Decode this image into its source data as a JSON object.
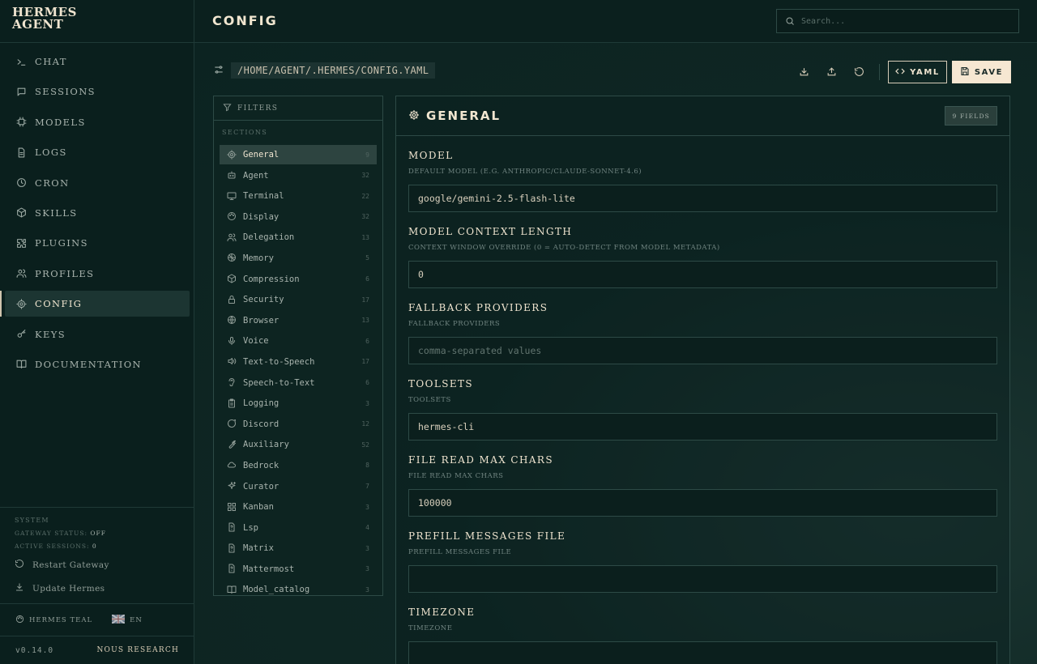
{
  "brand": {
    "line1": "HERMES",
    "line2": "AGENT"
  },
  "nav": [
    {
      "label": "CHAT",
      "icon": "terminal-icon",
      "active": false
    },
    {
      "label": "SESSIONS",
      "icon": "message-icon",
      "active": false
    },
    {
      "label": "MODELS",
      "icon": "cpu-icon",
      "active": false
    },
    {
      "label": "LOGS",
      "icon": "file-icon",
      "active": false
    },
    {
      "label": "CRON",
      "icon": "clock-icon",
      "active": false
    },
    {
      "label": "SKILLS",
      "icon": "package-icon",
      "active": false
    },
    {
      "label": "PLUGINS",
      "icon": "puzzle-icon",
      "active": false
    },
    {
      "label": "PROFILES",
      "icon": "users-icon",
      "active": false
    },
    {
      "label": "CONFIG",
      "icon": "gear-icon",
      "active": true
    },
    {
      "label": "KEYS",
      "icon": "key-icon",
      "active": false
    },
    {
      "label": "DOCUMENTATION",
      "icon": "book-icon",
      "active": false
    }
  ],
  "system": {
    "label": "SYSTEM",
    "gateway_label": "GATEWAY STATUS:",
    "gateway_value": "OFF",
    "sessions_label": "ACTIVE SESSIONS:",
    "sessions_value": "0",
    "restart": "Restart Gateway",
    "update": "Update Hermes"
  },
  "theme": {
    "name": "HERMES TEAL",
    "lang": "EN"
  },
  "footer": {
    "version": "v0.14.0",
    "company": "NOUS RESEARCH"
  },
  "header": {
    "title": "CONFIG",
    "search_placeholder": "Search..."
  },
  "toolbar": {
    "path": "/HOME/AGENT/.HERMES/CONFIG.YAML",
    "yaml_label": "YAML",
    "save_label": "SAVE"
  },
  "filters": {
    "title": "FILTERS",
    "sections_label": "SECTIONS"
  },
  "sections": [
    {
      "label": "General",
      "count": "9",
      "icon": "gear-icon",
      "active": true
    },
    {
      "label": "Agent",
      "count": "32",
      "icon": "bot-icon",
      "active": false
    },
    {
      "label": "Terminal",
      "count": "22",
      "icon": "monitor-icon",
      "active": false
    },
    {
      "label": "Display",
      "count": "32",
      "icon": "palette-icon",
      "active": false
    },
    {
      "label": "Delegation",
      "count": "13",
      "icon": "users-icon",
      "active": false
    },
    {
      "label": "Memory",
      "count": "5",
      "icon": "brain-icon",
      "active": false
    },
    {
      "label": "Compression",
      "count": "6",
      "icon": "package-icon",
      "active": false
    },
    {
      "label": "Security",
      "count": "17",
      "icon": "lock-icon",
      "active": false
    },
    {
      "label": "Browser",
      "count": "13",
      "icon": "globe-icon",
      "active": false
    },
    {
      "label": "Voice",
      "count": "6",
      "icon": "mic-icon",
      "active": false
    },
    {
      "label": "Text-to-Speech",
      "count": "17",
      "icon": "speaker-icon",
      "active": false
    },
    {
      "label": "Speech-to-Text",
      "count": "6",
      "icon": "ear-icon",
      "active": false
    },
    {
      "label": "Logging",
      "count": "3",
      "icon": "clipboard-icon",
      "active": false
    },
    {
      "label": "Discord",
      "count": "12",
      "icon": "message-circle-icon",
      "active": false
    },
    {
      "label": "Auxiliary",
      "count": "52",
      "icon": "wrench-icon",
      "active": false
    },
    {
      "label": "Bedrock",
      "count": "8",
      "icon": "cloud-icon",
      "active": false
    },
    {
      "label": "Curator",
      "count": "7",
      "icon": "sparkles-icon",
      "active": false
    },
    {
      "label": "Kanban",
      "count": "3",
      "icon": "grid-icon",
      "active": false
    },
    {
      "label": "Lsp",
      "count": "4",
      "icon": "help-file-icon",
      "active": false
    },
    {
      "label": "Matrix",
      "count": "3",
      "icon": "help-file-icon",
      "active": false
    },
    {
      "label": "Mattermost",
      "count": "3",
      "icon": "help-file-icon",
      "active": false
    },
    {
      "label": "Model_catalog",
      "count": "3",
      "icon": "book-open-icon",
      "active": false
    }
  ],
  "panel": {
    "title": "GENERAL",
    "badge": "9 FIELDS"
  },
  "fields": [
    {
      "label": "MODEL",
      "help": "DEFAULT MODEL (E.G. ANTHROPIC/CLAUDE-SONNET-4.6)",
      "value": "google/gemini-2.5-flash-lite",
      "placeholder": ""
    },
    {
      "label": "MODEL CONTEXT LENGTH",
      "help": "CONTEXT WINDOW OVERRIDE (0 = AUTO-DETECT FROM MODEL METADATA)",
      "value": "0",
      "placeholder": ""
    },
    {
      "label": "FALLBACK PROVIDERS",
      "help": "FALLBACK PROVIDERS",
      "value": "",
      "placeholder": "comma-separated values"
    },
    {
      "label": "TOOLSETS",
      "help": "TOOLSETS",
      "value": "hermes-cli",
      "placeholder": ""
    },
    {
      "label": "FILE READ MAX CHARS",
      "help": "FILE READ MAX CHARS",
      "value": "100000",
      "placeholder": ""
    },
    {
      "label": "PREFILL MESSAGES FILE",
      "help": "PREFILL MESSAGES FILE",
      "value": "",
      "placeholder": ""
    },
    {
      "label": "TIMEZONE",
      "help": "TIMEZONE",
      "value": "",
      "placeholder": ""
    }
  ]
}
